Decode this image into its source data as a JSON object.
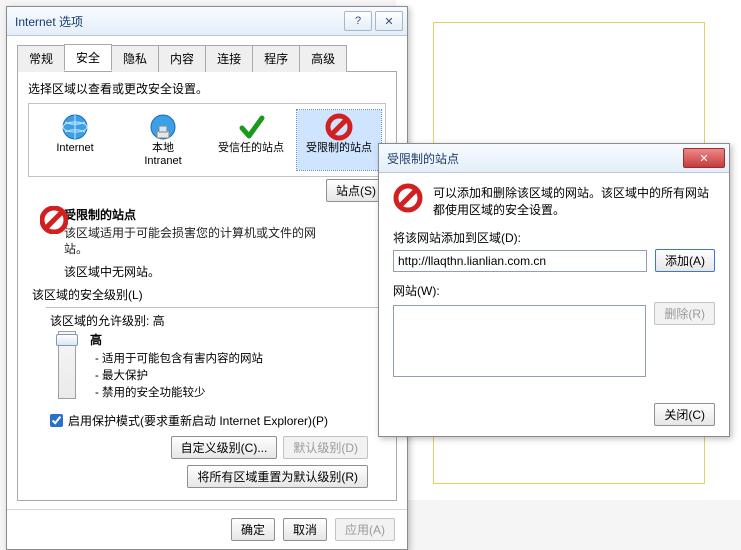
{
  "iopt": {
    "title": "Internet 选项",
    "tabs": [
      "常规",
      "安全",
      "隐私",
      "内容",
      "连接",
      "程序",
      "高级"
    ],
    "active_tab": 1,
    "prompt": "选择区域以查看或更改安全设置。",
    "zones": [
      {
        "label": "Internet"
      },
      {
        "label": "本地\nIntranet"
      },
      {
        "label": "受信任的站点"
      },
      {
        "label": "受限制的站点"
      }
    ],
    "selected_zone": 3,
    "zone_heading": "受限制的站点",
    "zone_desc": "该区域适用于可能会损害您的计算机或文件的网站。",
    "zone_empty": "该区域中无网站。",
    "sites_btn": "站点(S)",
    "level_group": "该区域的安全级别(L)",
    "level_allowed": "该区域的允许级别: 高",
    "level_value": "高",
    "level_bullets": [
      "适用于可能包含有害内容的网站",
      "最大保护",
      "禁用的安全功能较少"
    ],
    "protected_mode": "启用保护模式(要求重新启动 Internet Explorer)(P)",
    "protected_checked": true,
    "custom_btn": "自定义级别(C)...",
    "default_btn": "默认级别(D)",
    "reset_btn": "将所有区域重置为默认级别(R)",
    "ok": "确定",
    "cancel": "取消",
    "apply": "应用(A)"
  },
  "rsd": {
    "title": "受限制的站点",
    "msg": "可以添加和删除该区域的网站。该区域中的所有网站都使用区域的安全设置。",
    "add_label": "将该网站添加到区域(D):",
    "url": "http://llaqthn.lianlian.com.cn",
    "add_btn": "添加(A)",
    "list_label": "网站(W):",
    "remove_btn": "删除(R)",
    "close": "关闭(C)"
  },
  "win_ctrl": {
    "help": "?",
    "close": "✕"
  }
}
